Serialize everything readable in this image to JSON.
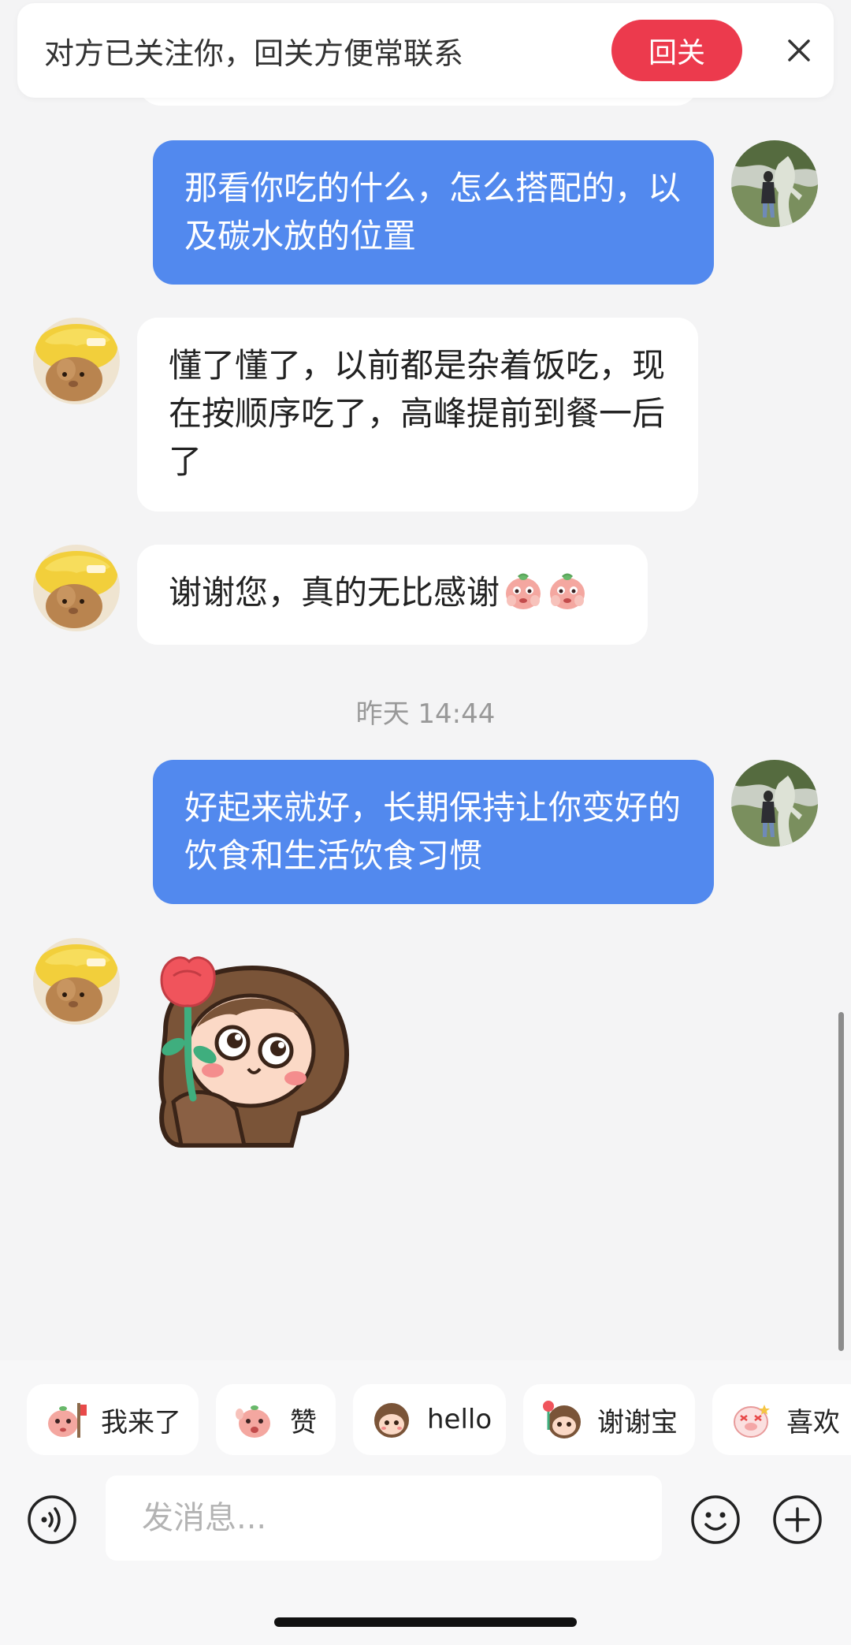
{
  "banner": {
    "text": "对方已关注你，回关方便常联系",
    "follow_button": "回关",
    "close_icon": "close-icon"
  },
  "messages": [
    {
      "direction": "outgoing",
      "text": "那看你吃的什么，怎么搭配的，以及碳水放的位置"
    },
    {
      "direction": "incoming",
      "text": "懂了懂了，以前都是杂着饭吃，现在按顺序吃了，高峰提前到餐一后了"
    },
    {
      "direction": "incoming",
      "text": "谢谢您，真的无比感谢",
      "emoji": [
        "peach-face-emoji",
        "peach-face-emoji"
      ]
    },
    {
      "direction": "outgoing",
      "text": "好起来就好，长期保持让你变好的饮食和生活饮食习惯"
    },
    {
      "direction": "incoming",
      "sticker": "girl-holding-rose-sticker"
    }
  ],
  "timestamp": "昨天 14:44",
  "quick_replies": [
    {
      "label": "我来了",
      "icon": "peach-flag-sticker-icon"
    },
    {
      "label": "赞",
      "icon": "peach-thumbs-sticker-icon"
    },
    {
      "label": "hello",
      "icon": "monkey-wave-sticker-icon"
    },
    {
      "label": "谢谢宝",
      "icon": "monkey-rose-sticker-icon"
    },
    {
      "label": "喜欢",
      "icon": "pig-love-sticker-icon"
    }
  ],
  "composer": {
    "placeholder": "发消息...",
    "voice_icon": "voice-icon",
    "emoji_icon": "smiley-icon",
    "plus_icon": "plus-icon"
  },
  "colors": {
    "outgoing_bubble": "#5289ee",
    "incoming_bubble": "#ffffff",
    "follow_button": "#ec3a4d",
    "background": "#f4f4f5"
  }
}
